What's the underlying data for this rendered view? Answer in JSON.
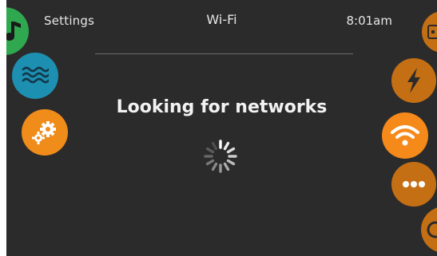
{
  "header": {
    "back_label": "Settings",
    "title": "Wi-Fi",
    "time": "8:01am"
  },
  "main": {
    "status_message": "Looking for networks"
  },
  "left_nav": {
    "items": [
      {
        "name": "music",
        "color": "#2fa84f"
      },
      {
        "name": "water",
        "color": "#1d8fb0"
      },
      {
        "name": "settings",
        "color": "#f08c1a"
      }
    ]
  },
  "right_nav": {
    "items": [
      {
        "name": "device",
        "color": "#c46f14"
      },
      {
        "name": "power",
        "color": "#c46f14"
      },
      {
        "name": "wifi",
        "color": "#f5891a"
      },
      {
        "name": "more",
        "color": "#c46f14"
      },
      {
        "name": "timer",
        "color": "#c46f14"
      }
    ]
  },
  "colors": {
    "background": "#2b2b2b",
    "text": "#e6e6e6",
    "accent_active": "#f5891a",
    "accent_inactive": "#c46f14"
  }
}
